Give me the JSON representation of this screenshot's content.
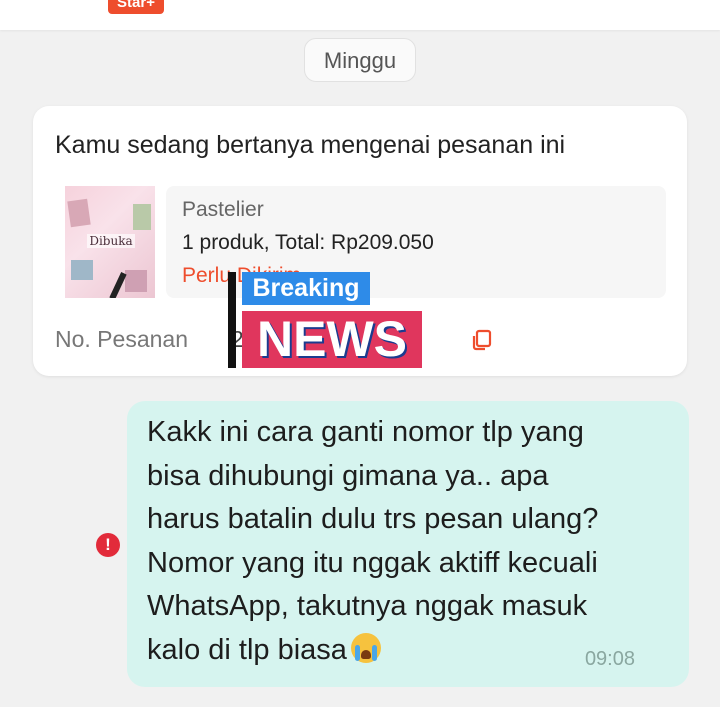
{
  "header": {
    "badge": "Star+"
  },
  "chat": {
    "day_separator": "Minggu",
    "order_card": {
      "heading": "Kamu sedang bertanya mengenai pesanan ini",
      "thumbnail_label": "Dibuka",
      "shop_name": "Pastelier",
      "summary": "1 produk, Total: Rp209.050",
      "status": "Perlu Dikirim",
      "order_no_label": "No. Pesanan",
      "order_no_value": "2                  494",
      "copy_icon": "copy-icon"
    },
    "message": {
      "text": "Kakk ini cara ganti nomor tlp yang\nbisa dihubungi gimana ya.. apa\nharus batalin dulu trs pesan ulang?\nNomor yang itu nggak aktiff kecuali\nWhatsApp, takutnya nggak masuk\nkalo di tlp biasa",
      "emoji": "crying-face-emoji",
      "time": "09:08",
      "error_icon": "!"
    }
  },
  "overlay": {
    "line1": "Breaking",
    "line2": "NEWS"
  },
  "colors": {
    "brand": "#ee4d2d",
    "bubble": "#d6f4ef",
    "error": "#e22b3a"
  }
}
